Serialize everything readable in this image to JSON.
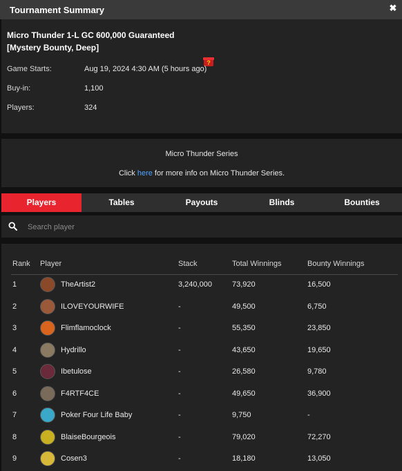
{
  "window": {
    "title": "Tournament Summary",
    "close_label": "✖"
  },
  "summary": {
    "tournament_name": "Micro Thunder 1-L GC 600,000 Guaranteed [Mystery Bounty, Deep]",
    "fields": [
      {
        "label": "Game Starts:",
        "value": "Aug 19, 2024 4:30 AM (5 hours ago)"
      },
      {
        "label": "Buy-in:",
        "value": "1,100"
      },
      {
        "label": "Players:",
        "value": "324"
      }
    ]
  },
  "series": {
    "title": "Micro Thunder Series",
    "info_prefix": "Click ",
    "info_link": "here",
    "info_suffix": " for more info on Micro Thunder Series."
  },
  "tabs": [
    {
      "label": "Players",
      "active": true
    },
    {
      "label": "Tables",
      "active": false
    },
    {
      "label": "Payouts",
      "active": false
    },
    {
      "label": "Blinds",
      "active": false
    },
    {
      "label": "Bounties",
      "active": false
    }
  ],
  "search": {
    "placeholder": "Search player",
    "value": ""
  },
  "table": {
    "headers": {
      "rank": "Rank",
      "player": "Player",
      "stack": "Stack",
      "total": "Total Winnings",
      "bounty": "Bounty Winnings"
    },
    "rows": [
      {
        "rank": "1",
        "player": "TheArtist2",
        "stack": "3,240,000",
        "total": "73,920",
        "bounty": "16,500",
        "avatar_color": "#8a4a2a"
      },
      {
        "rank": "2",
        "player": "ILOVEYOURWIFE",
        "stack": "-",
        "total": "49,500",
        "bounty": "6,750",
        "avatar_color": "#9a5a3a"
      },
      {
        "rank": "3",
        "player": "Flimflamoclock",
        "stack": "-",
        "total": "55,350",
        "bounty": "23,850",
        "avatar_color": "#d9641e"
      },
      {
        "rank": "4",
        "player": "Hydrillo",
        "stack": "-",
        "total": "43,650",
        "bounty": "19,650",
        "avatar_color": "#8a7a62"
      },
      {
        "rank": "5",
        "player": "Ibetulose",
        "stack": "-",
        "total": "26,580",
        "bounty": "9,780",
        "avatar_color": "#6a2a3a"
      },
      {
        "rank": "6",
        "player": "F4RTF4CE",
        "stack": "-",
        "total": "49,650",
        "bounty": "36,900",
        "avatar_color": "#7a6a5a"
      },
      {
        "rank": "7",
        "player": "Poker Four Life Baby",
        "stack": "-",
        "total": "9,750",
        "bounty": "-",
        "avatar_color": "#3aa8c8"
      },
      {
        "rank": "8",
        "player": "BlaiseBourgeois",
        "stack": "-",
        "total": "79,020",
        "bounty": "72,270",
        "avatar_color": "#c8b020"
      },
      {
        "rank": "9",
        "player": "Cosen3",
        "stack": "-",
        "total": "18,180",
        "bounty": "13,050",
        "avatar_color": "#d8b838"
      }
    ]
  },
  "colors": {
    "accent": "#e8242f",
    "link": "#4da3ff",
    "panel": "#232323",
    "background": "#111111"
  }
}
